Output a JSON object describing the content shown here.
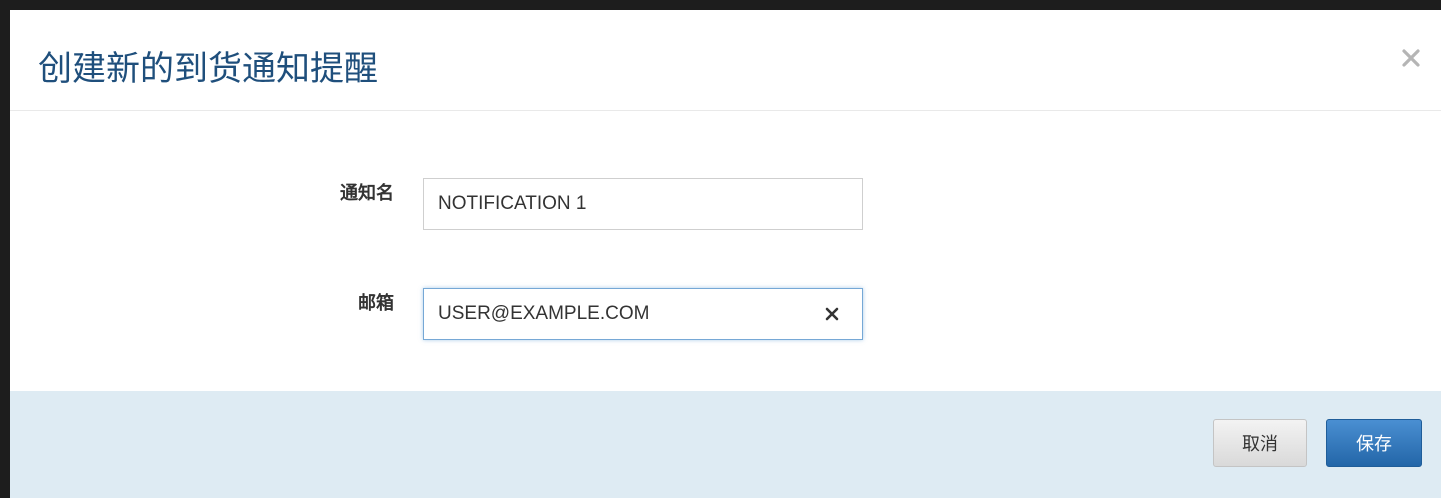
{
  "dialog": {
    "title": "创建新的到货通知提醒",
    "close_icon": "close-icon"
  },
  "form": {
    "name_field": {
      "label": "通知名",
      "value": "NOTIFICATION 1"
    },
    "email_field": {
      "label": "邮箱",
      "value": "USER@EXAMPLE.COM",
      "clear_icon": "clear-icon"
    }
  },
  "footer": {
    "cancel_label": "取消",
    "save_label": "保存"
  },
  "colors": {
    "title": "#1f4f7c",
    "footer_bg": "#deebf3",
    "primary_button": "#2e75bb",
    "focus_border": "#76a8d6"
  }
}
